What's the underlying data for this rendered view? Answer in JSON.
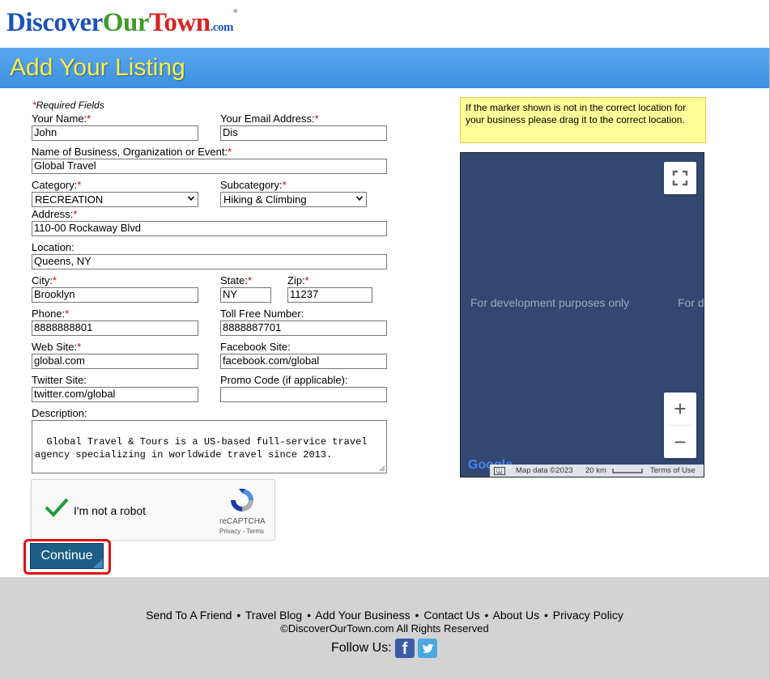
{
  "logo": {
    "part1": "Discover",
    "part2": "Our",
    "part3": "Town",
    "dotcom": ".com",
    "reg": "®"
  },
  "banner": {
    "title": "Add Your Listing"
  },
  "form": {
    "required_note": "Required Fields",
    "required_mark": "*",
    "name": {
      "label": "Your Name:",
      "value": "John"
    },
    "email": {
      "label": "Your Email Address:",
      "value": "Dis"
    },
    "business": {
      "label": "Name of Business, Organization or Event:",
      "value": "Global Travel"
    },
    "category": {
      "label": "Category:",
      "value": "RECREATION"
    },
    "subcategory": {
      "label": "Subcategory:",
      "value": "Hiking & Climbing"
    },
    "address": {
      "label": "Address:",
      "value": "110-00 Rockaway Blvd"
    },
    "location": {
      "label": "Location:",
      "value": "Queens, NY"
    },
    "city": {
      "label": "City:",
      "value": "Brooklyn"
    },
    "state": {
      "label": "State:",
      "value": "NY"
    },
    "zip": {
      "label": "Zip:",
      "value": "11237"
    },
    "phone": {
      "label": "Phone:",
      "value": "8888888801"
    },
    "tollfree": {
      "label": "Toll Free Number:",
      "value": "8888887701"
    },
    "website": {
      "label": "Web Site:",
      "value": "global.com"
    },
    "facebook": {
      "label": "Facebook Site:",
      "value": "facebook.com/global"
    },
    "twitter": {
      "label": "Twitter Site:",
      "value": "twitter.com/global"
    },
    "promo": {
      "label": "Promo Code (if applicable):",
      "value": ""
    },
    "description": {
      "label": "Description:",
      "value": "Global Travel & Tours is a US-based full-service travel\nagency specializing in worldwide travel since 2013."
    },
    "continue_label": "Continue"
  },
  "recaptcha": {
    "text": "I'm not a robot",
    "brand": "reCAPTCHA",
    "privacy": "Privacy",
    "terms": "Terms",
    "sep": " - "
  },
  "map": {
    "note": "If the marker shown is not in the correct location for your business please drag it to the correct location.",
    "dev_text": "For development purposes only",
    "dev_text_2": "For d",
    "logo_text": "Google",
    "map_data": "Map data ©2023",
    "scale": "20 km",
    "terms": "Terms of Use",
    "zoom_in": "+",
    "zoom_out": "−",
    "colors": {
      "background": "#334870"
    }
  },
  "footer": {
    "links": [
      "Send To A Friend",
      "Travel Blog",
      "Add Your Business",
      "Contact Us",
      "About Us",
      "Privacy Policy"
    ],
    "bullet": "•",
    "copyright": "©DiscoverOurTown.com All Rights Reserved",
    "follow": "Follow Us:",
    "facebook_glyph": "f"
  },
  "colors": {
    "banner": "#3d8fe0",
    "banner_title": "#ffee44",
    "required": "#cc0000",
    "continue_bg": "#1d5e86",
    "highlight": "#e01111",
    "footer_bg": "#d3d3d3"
  }
}
